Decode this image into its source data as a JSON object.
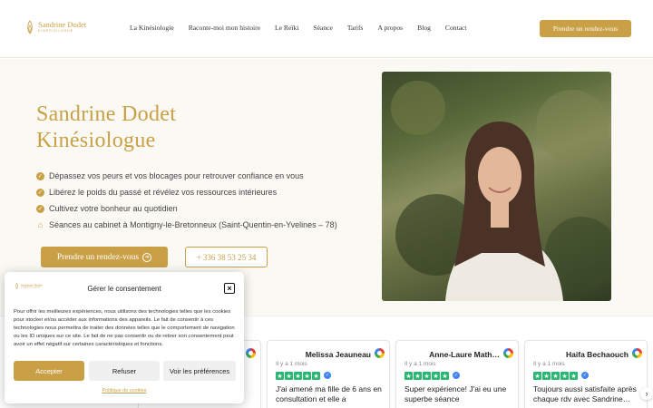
{
  "brand": {
    "name": "Sandrine Dodet",
    "subtitle": "KINÉSIOLOGUE",
    "accent": "#c9a046"
  },
  "nav": {
    "items": [
      "La Kinésiologie",
      "Raconte-moi mon histoire",
      "Le Reïki",
      "Séance",
      "Tarifs",
      "A propos",
      "Blog",
      "Contact"
    ],
    "cta": "Prendre un rendez-vous"
  },
  "hero": {
    "title_line1": "Sandrine Dodet",
    "title_line2": "Kinésiologue",
    "bullets": [
      "Dépassez vos peurs et vos blocages pour retrouver confiance en vous",
      "Libérez le poids du passé et révélez vos ressources intérieures",
      "Cultivez votre bonheur au quotidien",
      "Séances au cabinet à Montigny-le-Bretonneux (Saint-Quentin-en-Yvelines – 78)"
    ],
    "cta": "Prendre un rendez-vous",
    "phone": "+ 336 38 53 25 34"
  },
  "reviews": [
    {
      "name": "Melissa Jeauneau",
      "date": "Il y a 1 mois",
      "text": "J'ai amené ma fille de 6 ans en consultation et elle a"
    },
    {
      "name": "Anne-Laure Math…",
      "date": "Il y a 1 mois",
      "text": "Super expérience! J'ai eu une superbe séance"
    },
    {
      "name": "Haifa Bechaouch",
      "date": "Il y a 1 mois",
      "text": "Toujours aussi satisfaite après chaque rdv avec Sandrine…"
    }
  ],
  "consent": {
    "title": "Gérer le consentement",
    "close": "×",
    "text": "Pour offrir les meilleures expériences, nous utilisons des technologies telles que les cookies pour stocker et/ou accéder aux informations des appareils. Le fait de consentir à ces technologies nous permettra de traiter des données telles que le comportement de navigation ou les ID uniques sur ce site. Le fait de ne pas consentir ou de retirer son consentement peut avoir un effet négatif sur certaines caractéristiques et fonctions.",
    "accept": "Accepter",
    "refuse": "Refuser",
    "prefs": "Voir les préférences",
    "policy": "Politique de cookies",
    "logo_name": "Sandrine Dodet",
    "logo_sub": "KINÉSIOLOGUE"
  },
  "icons": {
    "check": "check-circle-icon",
    "house": "house-icon",
    "arrow": "arrow-right-circle-icon",
    "google": "google-icon",
    "star": "star-icon",
    "verified": "verified-icon",
    "next": "chevron-right-icon"
  }
}
